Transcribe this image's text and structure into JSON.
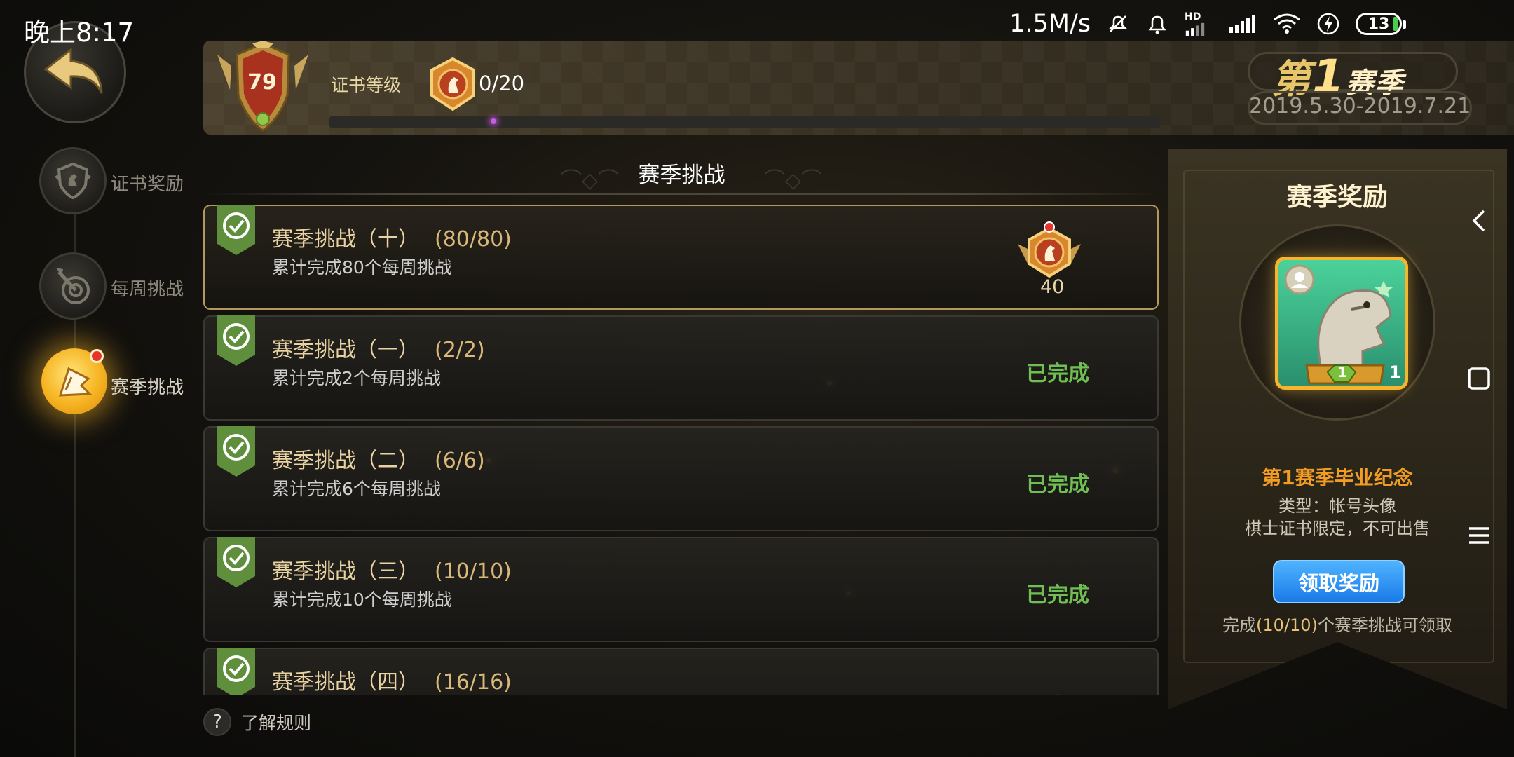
{
  "status_bar": {
    "time": "晚上8:17",
    "net_speed": "1.5M/s",
    "hd_label": "HD",
    "battery": "13"
  },
  "header": {
    "level": "79",
    "cert_label": "证书等级",
    "cert_progress_text": "0/20",
    "cert_progress_fraction": 0.0
  },
  "season": {
    "prefix": "第",
    "number": "1",
    "suffix": "赛季",
    "dates": "2019.5.30-2019.7.21"
  },
  "nav": {
    "items": [
      {
        "label": "证书奖励",
        "icon": "shield-horse-icon"
      },
      {
        "label": "每周挑战",
        "icon": "target-arrow-icon"
      },
      {
        "label": "赛季挑战",
        "icon": "flag-icon"
      }
    ]
  },
  "section_title": "赛季挑战",
  "challenges": [
    {
      "title": "赛季挑战（十）",
      "progress": "(80/80)",
      "desc": "累计完成80个每周挑战",
      "status": "",
      "reward_count": "40"
    },
    {
      "title": "赛季挑战（一）",
      "progress": "(2/2)",
      "desc": "累计完成2个每周挑战",
      "status": "已完成"
    },
    {
      "title": "赛季挑战（二）",
      "progress": "(6/6)",
      "desc": "累计完成6个每周挑战",
      "status": "已完成"
    },
    {
      "title": "赛季挑战（三）",
      "progress": "(10/10)",
      "desc": "累计完成10个每周挑战",
      "status": "已完成"
    },
    {
      "title": "赛季挑战（四）",
      "progress": "(16/16)",
      "desc": "",
      "status": "已完成"
    }
  ],
  "rules_label": "了解规则",
  "reward_panel": {
    "title": "赛季奖励",
    "item_name": "第1赛季毕业纪念",
    "item_type": "类型：帐号头像",
    "item_limit": "棋士证书限定，不可出售",
    "card_level": "1",
    "card_count": "1",
    "claim_button": "领取奖励",
    "hint_prefix": "完成",
    "hint_count": "(10/10)",
    "hint_suffix": "个赛季挑战可领取"
  },
  "colors": {
    "completed": "#6fbf52",
    "accent_gold": "#e9c56a",
    "claim_blue": "#1a7ae8",
    "reward_name": "#f39c24"
  }
}
